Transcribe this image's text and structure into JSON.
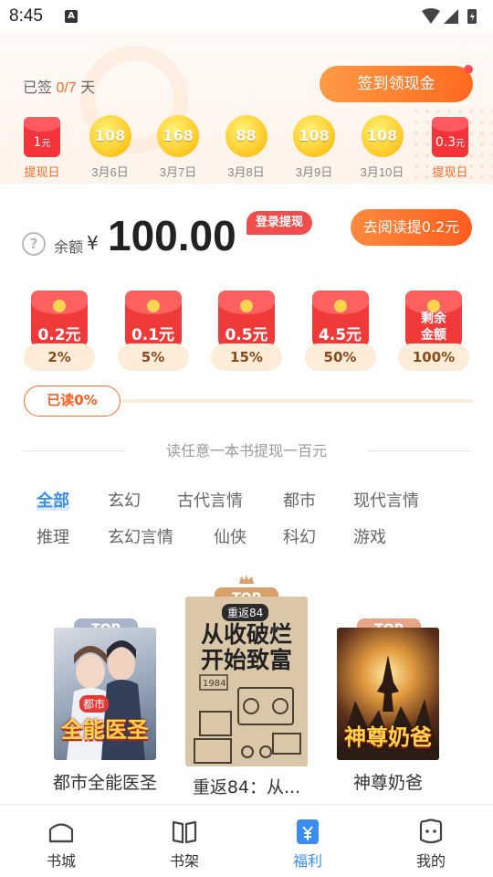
{
  "status": {
    "time": "8:45"
  },
  "checkin": {
    "signed_prefix": "已签 ",
    "signed_count": "0/7",
    "signed_suffix": " 天",
    "sign_button": "签到领现金",
    "days": [
      {
        "kind": "redbag",
        "amount": "1",
        "unit": "元",
        "label": "提现日",
        "highlight": true
      },
      {
        "kind": "coin",
        "amount": "108",
        "label": "3月6日"
      },
      {
        "kind": "coin",
        "amount": "168",
        "label": "3月7日"
      },
      {
        "kind": "coin",
        "amount": "88",
        "label": "3月8日"
      },
      {
        "kind": "coin",
        "amount": "108",
        "label": "3月9日"
      },
      {
        "kind": "coin",
        "amount": "108",
        "label": "3月10日"
      },
      {
        "kind": "redbag",
        "amount": "0.3",
        "unit": "元",
        "label": "提现日",
        "highlight": true
      }
    ]
  },
  "balance": {
    "help_icon": "question-icon",
    "label": "余额",
    "currency": "¥",
    "value": "100.00",
    "login_tag": "登录提现",
    "read_button": "去阅读提0.2元"
  },
  "packets": [
    {
      "amount": "0.2元",
      "percent": "2%"
    },
    {
      "amount": "0.1元",
      "percent": "5%"
    },
    {
      "amount": "0.5元",
      "percent": "15%"
    },
    {
      "amount": "4.5元",
      "percent": "50%"
    },
    {
      "amount": "剩余\n金额",
      "percent": "100%"
    }
  ],
  "progress": {
    "label": "已读0%",
    "fraction": 0.0
  },
  "section_title": "读任意一本书提现一百元",
  "categories": {
    "row1": [
      "全部",
      "玄幻",
      "古代言情",
      "都市",
      "现代言情"
    ],
    "row2": [
      "推理",
      "玄幻言情",
      "仙侠",
      "科幻",
      "游戏"
    ],
    "active": "全部"
  },
  "ranking": [
    {
      "rank": "TOP 2",
      "title": "都市全能医圣",
      "cover_text": "全能医圣",
      "cover_sub": "都市"
    },
    {
      "rank": "TOP 1",
      "title": "重返84：从...",
      "cover_text": "从收破烂开始致富",
      "cover_sub": "重返84"
    },
    {
      "rank": "TOP 3",
      "title": "神尊奶爸",
      "cover_text": "神尊奶爸",
      "cover_sub": ""
    }
  ],
  "bottom_nav": [
    {
      "label": "书城",
      "icon": "bookstore-icon"
    },
    {
      "label": "书架",
      "icon": "bookshelf-icon"
    },
    {
      "label": "福利",
      "icon": "welfare-icon",
      "active": true
    },
    {
      "label": "我的",
      "icon": "profile-icon"
    }
  ],
  "colors": {
    "accent": "#ff6b2c",
    "blue": "#3b8cf0",
    "red": "#f03a3a"
  }
}
